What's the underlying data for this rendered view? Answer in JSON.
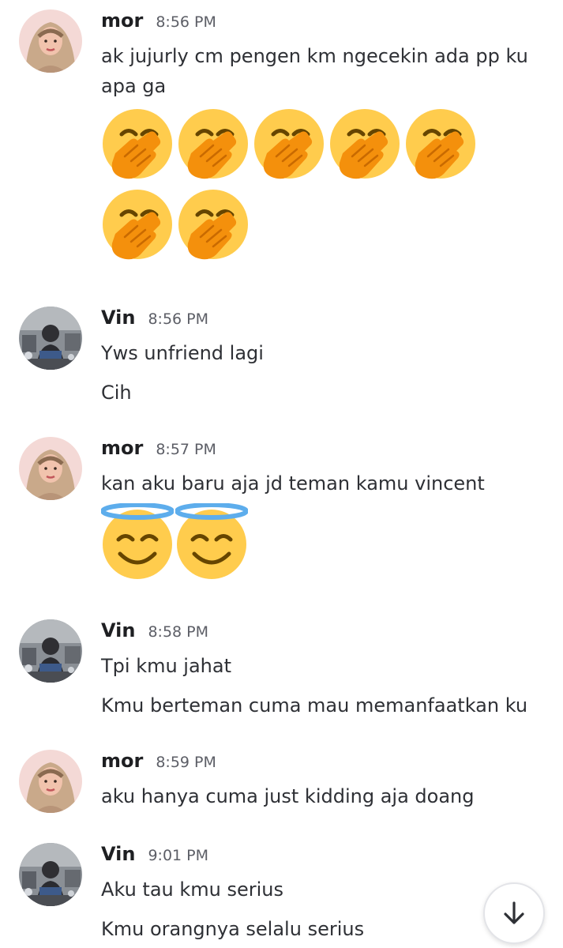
{
  "users": {
    "mor": {
      "name": "mor"
    },
    "vin": {
      "name": "Vin"
    }
  },
  "messages": [
    {
      "author": "mor",
      "time": "8:56 PM",
      "lines": [
        "ak jujurly cm pengen km ngecekin ada pp ku",
        "apa ga"
      ],
      "emojis": [
        "face-with-hand-over-mouth",
        "face-with-hand-over-mouth",
        "face-with-hand-over-mouth",
        "face-with-hand-over-mouth",
        "face-with-hand-over-mouth",
        "face-with-hand-over-mouth",
        "face-with-hand-over-mouth"
      ]
    },
    {
      "author": "Vin",
      "time": "8:56 PM",
      "lines": [
        "Yws unfriend lagi",
        "Cih"
      ]
    },
    {
      "author": "mor",
      "time": "8:57 PM",
      "lines": [
        "kan aku baru aja jd teman kamu vincent"
      ],
      "emojis": [
        "smiling-face-with-halo",
        "smiling-face-with-halo"
      ]
    },
    {
      "author": "Vin",
      "time": "8:58 PM",
      "lines": [
        "Tpi kmu jahat",
        "Kmu berteman cuma mau memanfaatkan ku"
      ]
    },
    {
      "author": "mor",
      "time": "8:59 PM",
      "lines": [
        "aku hanya cuma just kidding aja doang"
      ]
    },
    {
      "author": "Vin",
      "time": "9:01 PM",
      "lines": [
        "Aku tau kmu serius",
        "Kmu orangnya selalu serius"
      ]
    }
  ],
  "scroll_button": {
    "icon": "arrow-down-icon"
  },
  "colors": {
    "name": "#1e1f22",
    "timestamp": "#5c5e66",
    "text": "#2e3035"
  }
}
